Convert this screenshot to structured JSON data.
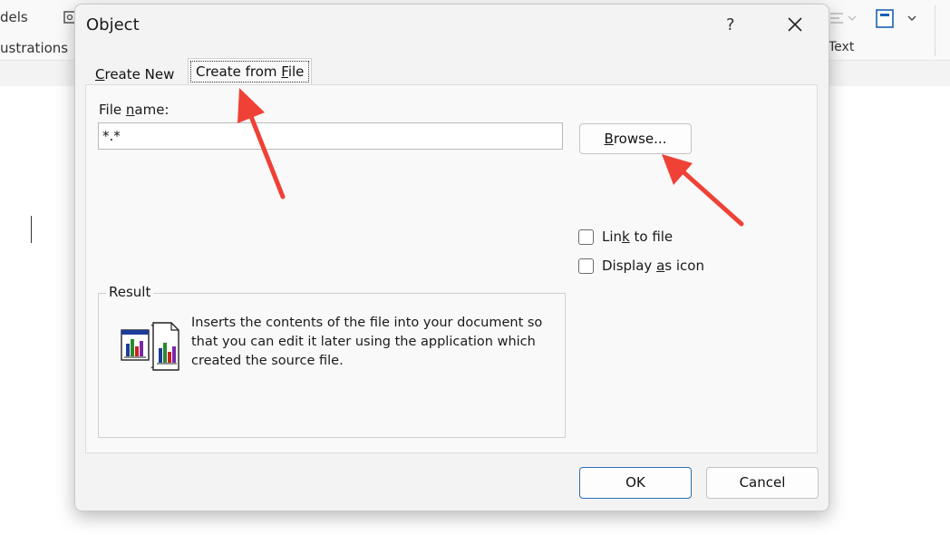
{
  "background_ribbon": {
    "left_top_text": "dels",
    "left_group_label": "ustrations",
    "right_group_label": "Text"
  },
  "dialog": {
    "title": "Object",
    "help_label": "?",
    "tabs": [
      {
        "label_pre": "",
        "label_key": "C",
        "label_post": "reate New",
        "active": false
      },
      {
        "label_pre": "Create from ",
        "label_key": "F",
        "label_post": "ile",
        "active": true
      }
    ],
    "file_name": {
      "label_pre": "File ",
      "label_key": "n",
      "label_post": "ame:",
      "value": "*.*"
    },
    "browse_button": {
      "label_pre": "",
      "label_key": "B",
      "label_post": "rowse..."
    },
    "checkboxes": [
      {
        "label_pre": "Lin",
        "label_key": "k",
        "label_post": " to file",
        "checked": false
      },
      {
        "label_pre": "Display ",
        "label_key": "a",
        "label_post": "s icon",
        "checked": false
      }
    ],
    "result": {
      "legend": "Result",
      "text": "Inserts the contents of the file into your document so that you can edit it later using the application which created the source file."
    },
    "ok_label": "OK",
    "cancel_label": "Cancel"
  },
  "colors": {
    "annotation_arrow": "#ef4136",
    "ok_border": "#2a6fb5"
  }
}
